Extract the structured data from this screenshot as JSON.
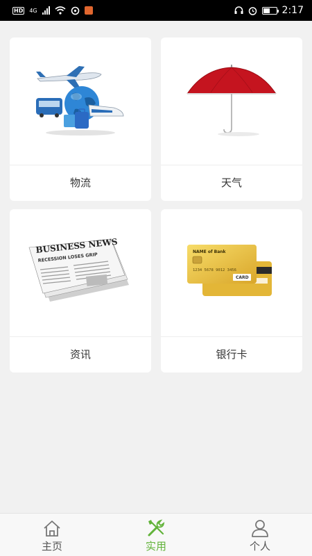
{
  "status_bar": {
    "time": "2:17",
    "hd_badge": "HD",
    "network_type": "4G",
    "battery_fill_fraction": 0.55
  },
  "cards": [
    {
      "label": "物流",
      "icon": "logistics-image"
    },
    {
      "label": "天气",
      "icon": "umbrella-image"
    },
    {
      "label": "资讯",
      "icon": "newspaper-image"
    },
    {
      "label": "银行卡",
      "icon": "bank-card-image"
    }
  ],
  "images": {
    "newspaper_headline": "BUSINESS NEWS",
    "newspaper_subhead": "RECESSION LOSES GRIP",
    "bank_card_name": "NAME of Bank",
    "bank_card_number": "1234 5678 9012 3456",
    "bank_card_badge": "CARD"
  },
  "bottom_nav": {
    "items": [
      {
        "label": "主页",
        "icon": "home-icon",
        "active": false
      },
      {
        "label": "实用",
        "icon": "tools-icon",
        "active": true
      },
      {
        "label": "个人",
        "icon": "person-icon",
        "active": false
      }
    ]
  },
  "colors": {
    "accent": "#62b33a",
    "background": "#f1f1f1",
    "card": "#ffffff"
  }
}
